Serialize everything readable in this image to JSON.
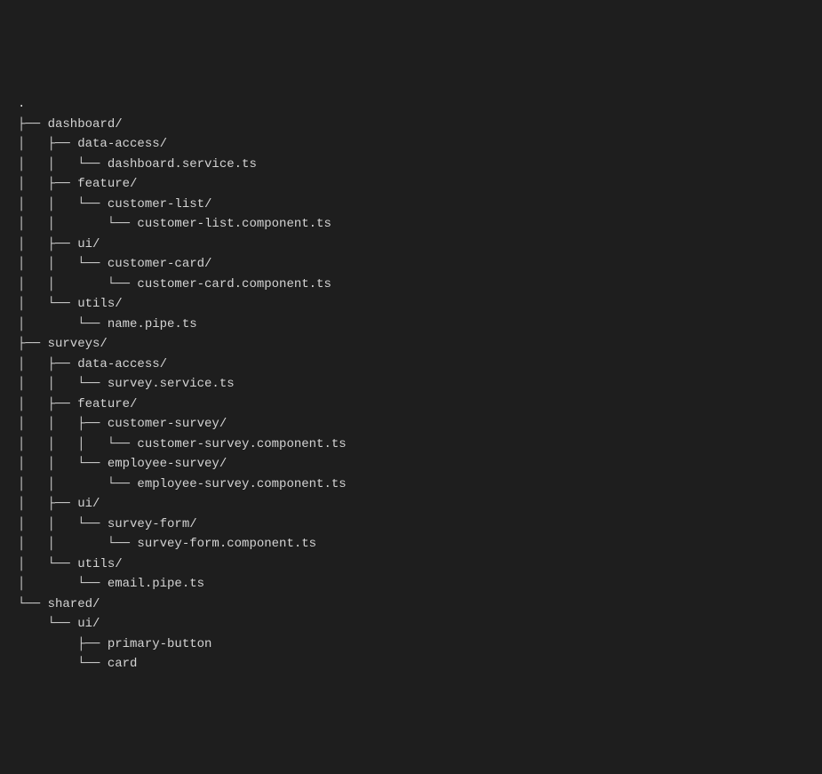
{
  "tree": {
    "root": ".",
    "lines": [
      ".",
      "├── dashboard/",
      "│   ├── data-access/",
      "│   │   └── dashboard.service.ts",
      "│   ├── feature/",
      "│   │   └── customer-list/",
      "│   │       └── customer-list.component.ts",
      "│   ├── ui/",
      "│   │   └── customer-card/",
      "│   │       └── customer-card.component.ts",
      "│   └── utils/",
      "│       └── name.pipe.ts",
      "├── surveys/",
      "│   ├── data-access/",
      "│   │   └── survey.service.ts",
      "│   ├── feature/",
      "│   │   ├── customer-survey/",
      "│   │   │   └── customer-survey.component.ts",
      "│   │   └── employee-survey/",
      "│   │       └── employee-survey.component.ts",
      "│   ├── ui/",
      "│   │   └── survey-form/",
      "│   │       └── survey-form.component.ts",
      "│   └── utils/",
      "│       └── email.pipe.ts",
      "└── shared/",
      "    └── ui/",
      "        ├── primary-button",
      "        └── card"
    ]
  }
}
